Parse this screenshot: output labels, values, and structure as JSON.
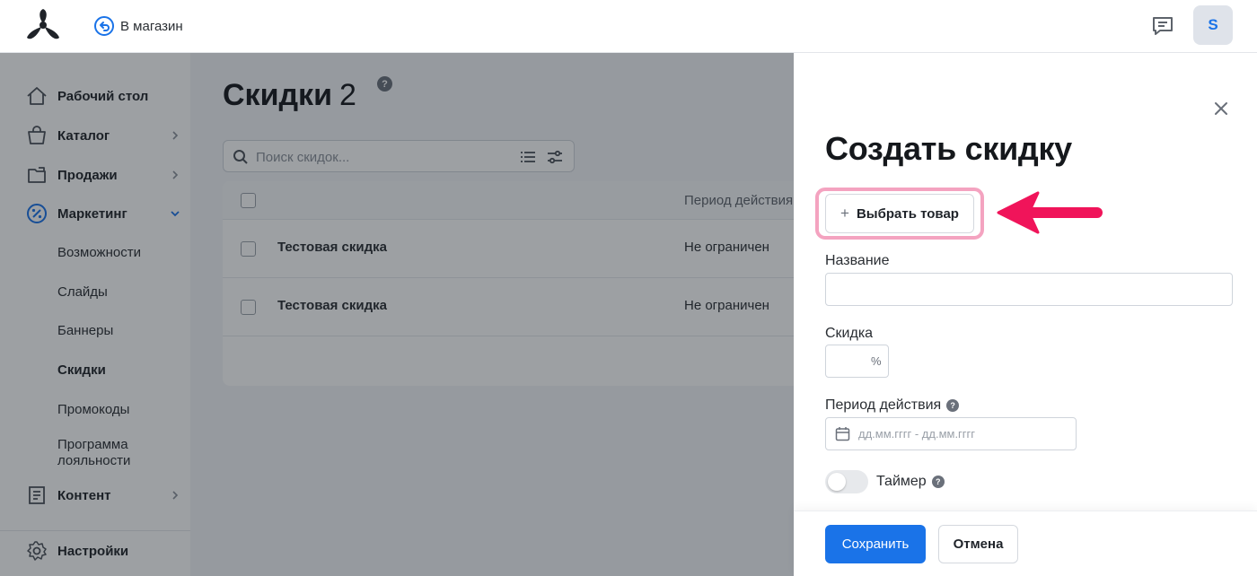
{
  "colors": {
    "accent": "#1a73e8",
    "highlight": "#f4a3c0",
    "arrow": "#f0145a",
    "avatar_bg": "#dfe3ea"
  },
  "topbar": {
    "back_label": "В магазин",
    "avatar_letter": "S"
  },
  "sidebar": {
    "items": [
      {
        "label": "Рабочий стол",
        "icon": "home-icon"
      },
      {
        "label": "Каталог",
        "icon": "bag-icon"
      },
      {
        "label": "Продажи",
        "icon": "folder-icon"
      },
      {
        "label": "Маркетинг",
        "icon": "percent-icon"
      },
      {
        "label": "Контент",
        "icon": "document-icon"
      }
    ],
    "marketing_sub": [
      "Возможности",
      "Слайды",
      "Баннеры",
      "Скидки",
      "Промокоды",
      "Программа",
      "лояльности"
    ],
    "settings_label": "Настройки"
  },
  "main": {
    "title": "Скидки",
    "count": "2",
    "help": "?",
    "search_placeholder": "Поиск скидок...",
    "table": {
      "col_period": "Период действия",
      "rows": [
        {
          "name": "Тестовая скидка",
          "period": "Не ограничен"
        },
        {
          "name": "Тестовая скидка",
          "period": "Не ограничен"
        }
      ]
    }
  },
  "drawer": {
    "title": "Создать скидку",
    "pick_button": "Выбрать товар",
    "plus": "+",
    "name_label": "Название",
    "discount_label": "Скидка",
    "percent_sign": "%",
    "period_label": "Период действия",
    "period_placeholder": "дд.мм.гггг - дд.мм.гггг",
    "timer_label": "Таймер",
    "save_label": "Сохранить",
    "cancel_label": "Отмена"
  }
}
